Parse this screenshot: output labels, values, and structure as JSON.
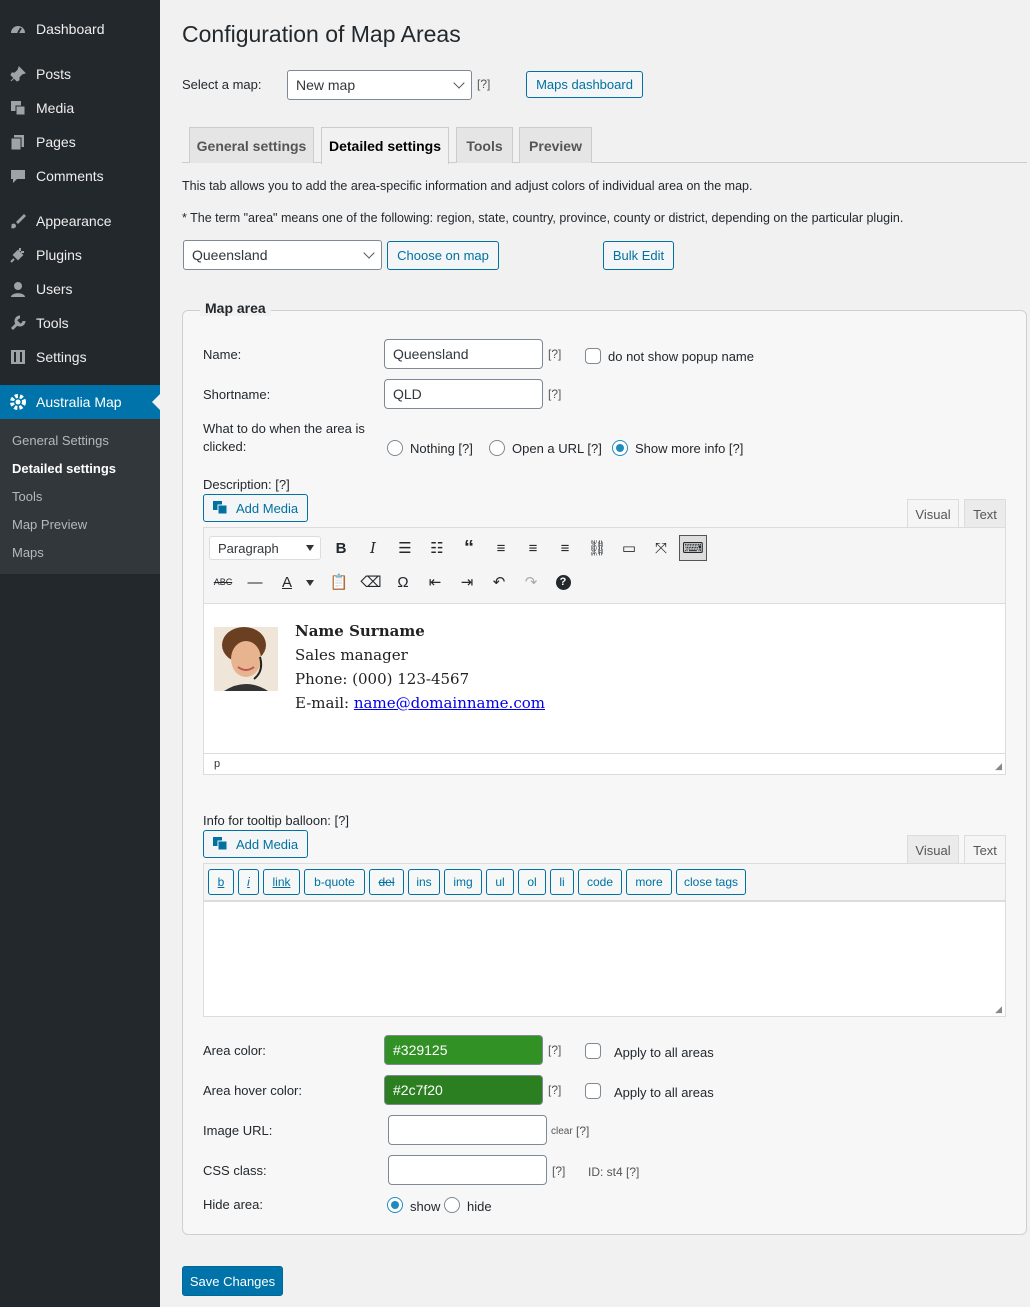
{
  "sidebar": {
    "items": [
      {
        "label": "Dashboard",
        "icon": "dashboard-icon"
      },
      {
        "label": "Posts",
        "icon": "pin-icon"
      },
      {
        "label": "Media",
        "icon": "media-icon"
      },
      {
        "label": "Pages",
        "icon": "pages-icon"
      },
      {
        "label": "Comments",
        "icon": "comment-icon"
      },
      {
        "label": "Appearance",
        "icon": "brush-icon"
      },
      {
        "label": "Plugins",
        "icon": "plug-icon"
      },
      {
        "label": "Users",
        "icon": "user-icon"
      },
      {
        "label": "Tools",
        "icon": "wrench-icon"
      },
      {
        "label": "Settings",
        "icon": "settings-icon"
      },
      {
        "label": "Australia Map",
        "icon": "gear-icon"
      }
    ],
    "submenu": [
      "General Settings",
      "Detailed settings",
      "Tools",
      "Map Preview",
      "Maps"
    ]
  },
  "page": {
    "title": "Configuration of Map Areas",
    "select_map_label": "Select a map:",
    "selected_map": "New map",
    "help": "[?]",
    "maps_dashboard": "Maps dashboard",
    "tabs": [
      "General settings",
      "Detailed settings",
      "Tools",
      "Preview"
    ],
    "intro1": "This tab allows you to add the area-specific information and adjust colors of individual area on the map.",
    "intro2": "* The term \"area\" means one of the following: region, state, country, province, county or district, depending on the particular plugin.",
    "area_select": "Queensland",
    "choose_on_map": "Choose on map",
    "bulk_edit": "Bulk Edit"
  },
  "form": {
    "legend": "Map area",
    "name_label": "Name:",
    "name_value": "Queensland",
    "no_popup": "do not show popup name",
    "shortname_label": "Shortname:",
    "shortname_value": "QLD",
    "click_label_1": "What to do when the area is",
    "click_label_2": "clicked:",
    "opt_nothing": "Nothing [?]",
    "opt_url": "Open a URL [?]",
    "opt_more": "Show more info [?]",
    "description_label": "Description: [?]",
    "add_media": "Add Media",
    "tab_visual": "Visual",
    "tab_text": "Text",
    "paragraph": "Paragraph",
    "path": "p",
    "contact": {
      "name": "Name Surname",
      "role": "Sales manager",
      "phone": "Phone: (000) 123-4567",
      "email_label": "E-mail: ",
      "email": "name@domainname.com"
    },
    "tooltip_label": "Info for tooltip balloon: [?]",
    "quicktags": [
      "b",
      "i",
      "link",
      "b-quote",
      "del",
      "ins",
      "img",
      "ul",
      "ol",
      "li",
      "code",
      "more",
      "close tags"
    ],
    "area_color_label": "Area color:",
    "area_color": "#329125",
    "hover_color_label": "Area hover color:",
    "hover_color": "#2c7f20",
    "apply_all": "Apply to all areas",
    "image_url_label": "Image URL:",
    "clear": "clear",
    "css_label": "CSS class:",
    "id_text": "ID: st4 [?]",
    "hide_label": "Hide area:",
    "show": "show",
    "hide": "hide"
  },
  "save": "Save Changes"
}
